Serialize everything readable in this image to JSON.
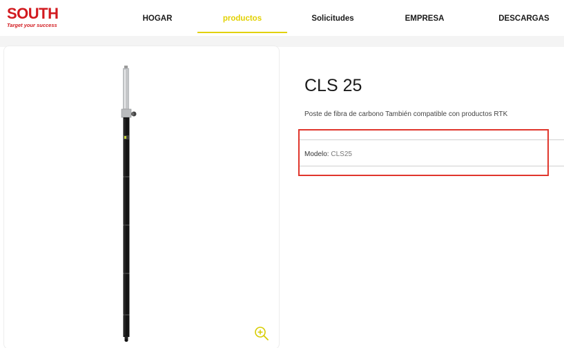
{
  "header": {
    "logo": {
      "main": "SOUTH",
      "tagline": "Target your success"
    },
    "nav": [
      {
        "label": "HOGAR",
        "active": false
      },
      {
        "label": "productos",
        "active": true
      },
      {
        "label": "Solicitudes",
        "active": false
      },
      {
        "label": "EMPRESA",
        "active": false
      },
      {
        "label": "DESCARGAS",
        "active": false
      }
    ],
    "accent_color": "#e2d100",
    "brand_color": "#d21a1f"
  },
  "product": {
    "image_icon": "carbon-fiber-pole-image",
    "zoom_icon": "zoom-in-icon",
    "title": "CLS 25",
    "description": "Poste de fibra de carbono También compatible con productos RTK",
    "model_label": "Modelo: ",
    "model_value": "CLS25"
  },
  "highlight_color": "#e0352b"
}
